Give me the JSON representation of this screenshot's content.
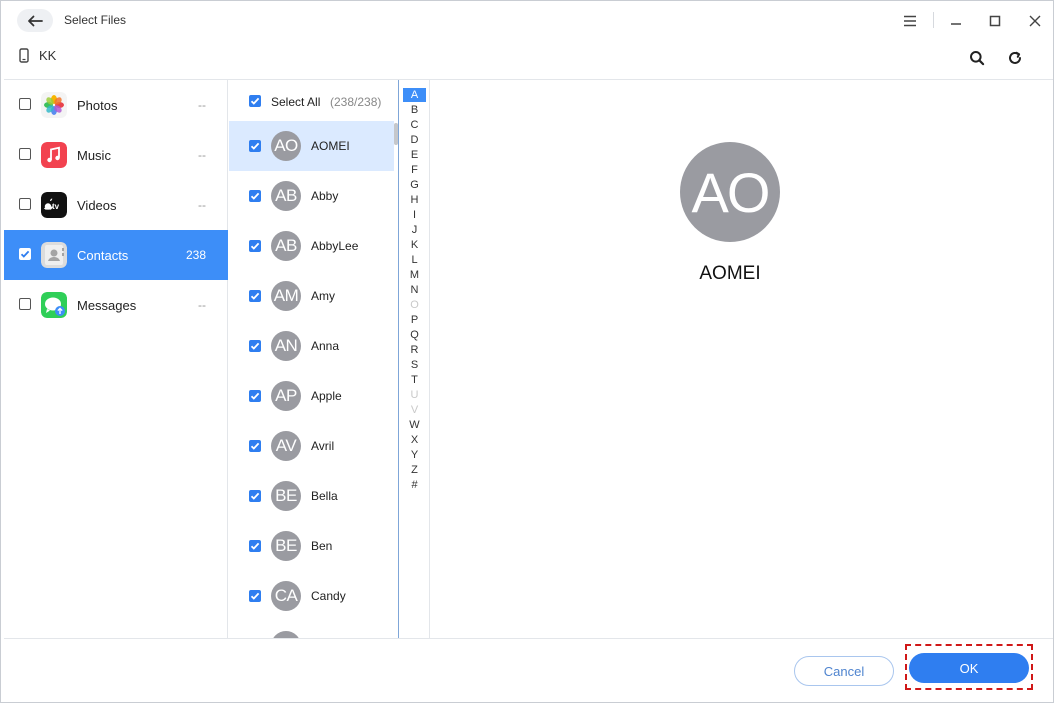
{
  "window": {
    "title": "Select Files"
  },
  "icons": {
    "back": "arrow-left-icon",
    "menu": "hamburger-menu-icon",
    "minimize": "minimize-icon",
    "maximize": "maximize-icon",
    "close": "close-icon",
    "device": "phone-icon",
    "search": "search-icon",
    "refresh": "refresh-icon"
  },
  "device": {
    "name": "KK"
  },
  "colors": {
    "accent": "#3d8ef8",
    "checkbox": "#2f7ef0",
    "avatar": "#9a9ba1",
    "highlight": "#d01818"
  },
  "sidebar": {
    "items": [
      {
        "label": "Photos",
        "count": "--",
        "checked": false,
        "active": false,
        "icon": "photos-icon"
      },
      {
        "label": "Music",
        "count": "--",
        "checked": false,
        "active": false,
        "icon": "music-icon"
      },
      {
        "label": "Videos",
        "count": "--",
        "checked": false,
        "active": false,
        "icon": "apple-tv-icon"
      },
      {
        "label": "Contacts",
        "count": "238",
        "checked": true,
        "active": true,
        "icon": "contacts-icon"
      },
      {
        "label": "Messages",
        "count": "--",
        "checked": false,
        "active": false,
        "icon": "messages-icon"
      }
    ]
  },
  "contacts": {
    "select_all_label": "Select All",
    "select_all_count": "(238/238)",
    "list": [
      {
        "initials": "AO",
        "name": "AOMEI",
        "checked": true,
        "selected": true
      },
      {
        "initials": "AB",
        "name": "Abby",
        "checked": true,
        "selected": false
      },
      {
        "initials": "AB",
        "name": "AbbyLee",
        "checked": true,
        "selected": false
      },
      {
        "initials": "AM",
        "name": "Amy",
        "checked": true,
        "selected": false
      },
      {
        "initials": "AN",
        "name": "Anna",
        "checked": true,
        "selected": false
      },
      {
        "initials": "AP",
        "name": "Apple",
        "checked": true,
        "selected": false
      },
      {
        "initials": "AV",
        "name": "Avril",
        "checked": true,
        "selected": false
      },
      {
        "initials": "BE",
        "name": "Bella",
        "checked": true,
        "selected": false
      },
      {
        "initials": "BE",
        "name": "Ben",
        "checked": true,
        "selected": false
      },
      {
        "initials": "CA",
        "name": "Candy",
        "checked": true,
        "selected": false
      }
    ]
  },
  "alphabet": {
    "letters": [
      "A",
      "B",
      "C",
      "D",
      "E",
      "F",
      "G",
      "H",
      "I",
      "J",
      "K",
      "L",
      "M",
      "N",
      "O",
      "P",
      "Q",
      "R",
      "S",
      "T",
      "U",
      "V",
      "W",
      "X",
      "Y",
      "Z",
      "#"
    ],
    "active": "A",
    "disabled": [
      "O",
      "U",
      "V"
    ]
  },
  "detail": {
    "initials": "AO",
    "name": "AOMEI"
  },
  "footer": {
    "cancel_label": "Cancel",
    "ok_label": "OK"
  }
}
